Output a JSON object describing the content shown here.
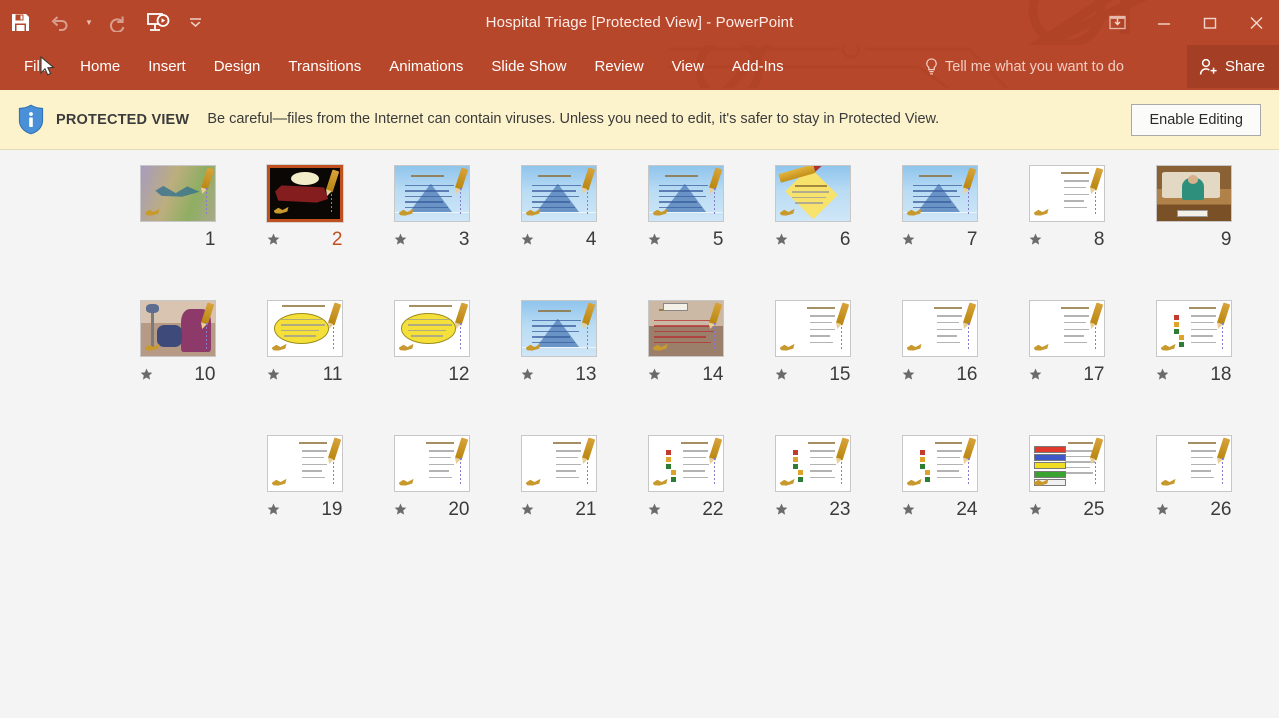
{
  "window": {
    "title": "Hospital Triage [Protected View] - PowerPoint",
    "quick_access": [
      {
        "name": "save-icon",
        "label": "Save"
      },
      {
        "name": "undo-icon",
        "label": "Undo"
      },
      {
        "name": "redo-icon",
        "label": "Redo"
      },
      {
        "name": "start-slideshow-icon",
        "label": "Start From Beginning"
      },
      {
        "name": "customize-quick-access-toolbar-icon",
        "label": "Customize Quick Access Toolbar"
      }
    ],
    "controls": [
      {
        "name": "ribbon-display-options-icon",
        "label": "Ribbon Display Options"
      },
      {
        "name": "minimize-icon",
        "label": "Minimize"
      },
      {
        "name": "restore-icon",
        "label": "Restore Down"
      },
      {
        "name": "close-icon",
        "label": "Close"
      }
    ]
  },
  "ribbon": {
    "tabs": [
      "File",
      "Home",
      "Insert",
      "Design",
      "Transitions",
      "Animations",
      "Slide Show",
      "Review",
      "View",
      "Add-Ins"
    ],
    "tell_me": "Tell me what you want to do",
    "share": "Share"
  },
  "protected_view": {
    "badge": "PROTECTED VIEW",
    "message": "Be careful—files from the Internet can contain viruses. Unless you need to edit, it's safer to stay in Protected View.",
    "enable_button": "Enable Editing",
    "icon": "info-shield-icon"
  },
  "colors": {
    "titlebar": "#b7472a",
    "protected_bar": "#fcf3cd",
    "selection": "#c0501f",
    "workspace": "#f4f4f4"
  },
  "slide_sorter": {
    "rows": [
      {
        "slides": [
          {
            "number": "9",
            "animated": false,
            "selected": false,
            "art": "desk-photo"
          },
          {
            "number": "8",
            "animated": true,
            "selected": false,
            "art": "title-bullets"
          },
          {
            "number": "7",
            "animated": true,
            "selected": false,
            "art": "sky-text"
          },
          {
            "number": "6",
            "animated": true,
            "selected": false,
            "art": "diamond"
          },
          {
            "number": "5",
            "animated": true,
            "selected": false,
            "art": "sky-text"
          },
          {
            "number": "4",
            "animated": true,
            "selected": false,
            "art": "sky-text"
          },
          {
            "number": "3",
            "animated": true,
            "selected": false,
            "art": "sky-text"
          },
          {
            "number": "2",
            "animated": true,
            "selected": true,
            "art": "triage-title"
          },
          {
            "number": "1",
            "animated": false,
            "selected": false,
            "art": "water-title"
          }
        ]
      },
      {
        "slides": [
          {
            "number": "18",
            "animated": true,
            "selected": false,
            "art": "text-swatches"
          },
          {
            "number": "17",
            "animated": true,
            "selected": false,
            "art": "text-bullets"
          },
          {
            "number": "16",
            "animated": true,
            "selected": false,
            "art": "text-bullets"
          },
          {
            "number": "15",
            "animated": true,
            "selected": false,
            "art": "text-bullets"
          },
          {
            "number": "14",
            "animated": true,
            "selected": false,
            "art": "ward-photo"
          },
          {
            "number": "13",
            "animated": true,
            "selected": false,
            "art": "sky-text"
          },
          {
            "number": "12",
            "animated": false,
            "selected": false,
            "art": "ellipse"
          },
          {
            "number": "11",
            "animated": true,
            "selected": false,
            "art": "ellipse"
          },
          {
            "number": "10",
            "animated": true,
            "selected": false,
            "art": "room-photo"
          }
        ]
      },
      {
        "slides": [
          {
            "number": "26",
            "animated": true,
            "selected": false,
            "art": "text-bullets"
          },
          {
            "number": "25",
            "animated": true,
            "selected": false,
            "art": "color-table"
          },
          {
            "number": "24",
            "animated": true,
            "selected": false,
            "art": "text-swatches"
          },
          {
            "number": "23",
            "animated": true,
            "selected": false,
            "art": "text-swatches"
          },
          {
            "number": "22",
            "animated": true,
            "selected": false,
            "art": "text-swatches"
          },
          {
            "number": "21",
            "animated": true,
            "selected": false,
            "art": "text-bullets"
          },
          {
            "number": "20",
            "animated": true,
            "selected": false,
            "art": "text-bullets"
          },
          {
            "number": "19",
            "animated": true,
            "selected": false,
            "art": "text-bullets"
          }
        ]
      }
    ],
    "animation_marker_name": "animation-star-icon",
    "table_colors": [
      "#e03a2f",
      "#3f58c8",
      "#f2dd25",
      "#3aa32f"
    ]
  }
}
